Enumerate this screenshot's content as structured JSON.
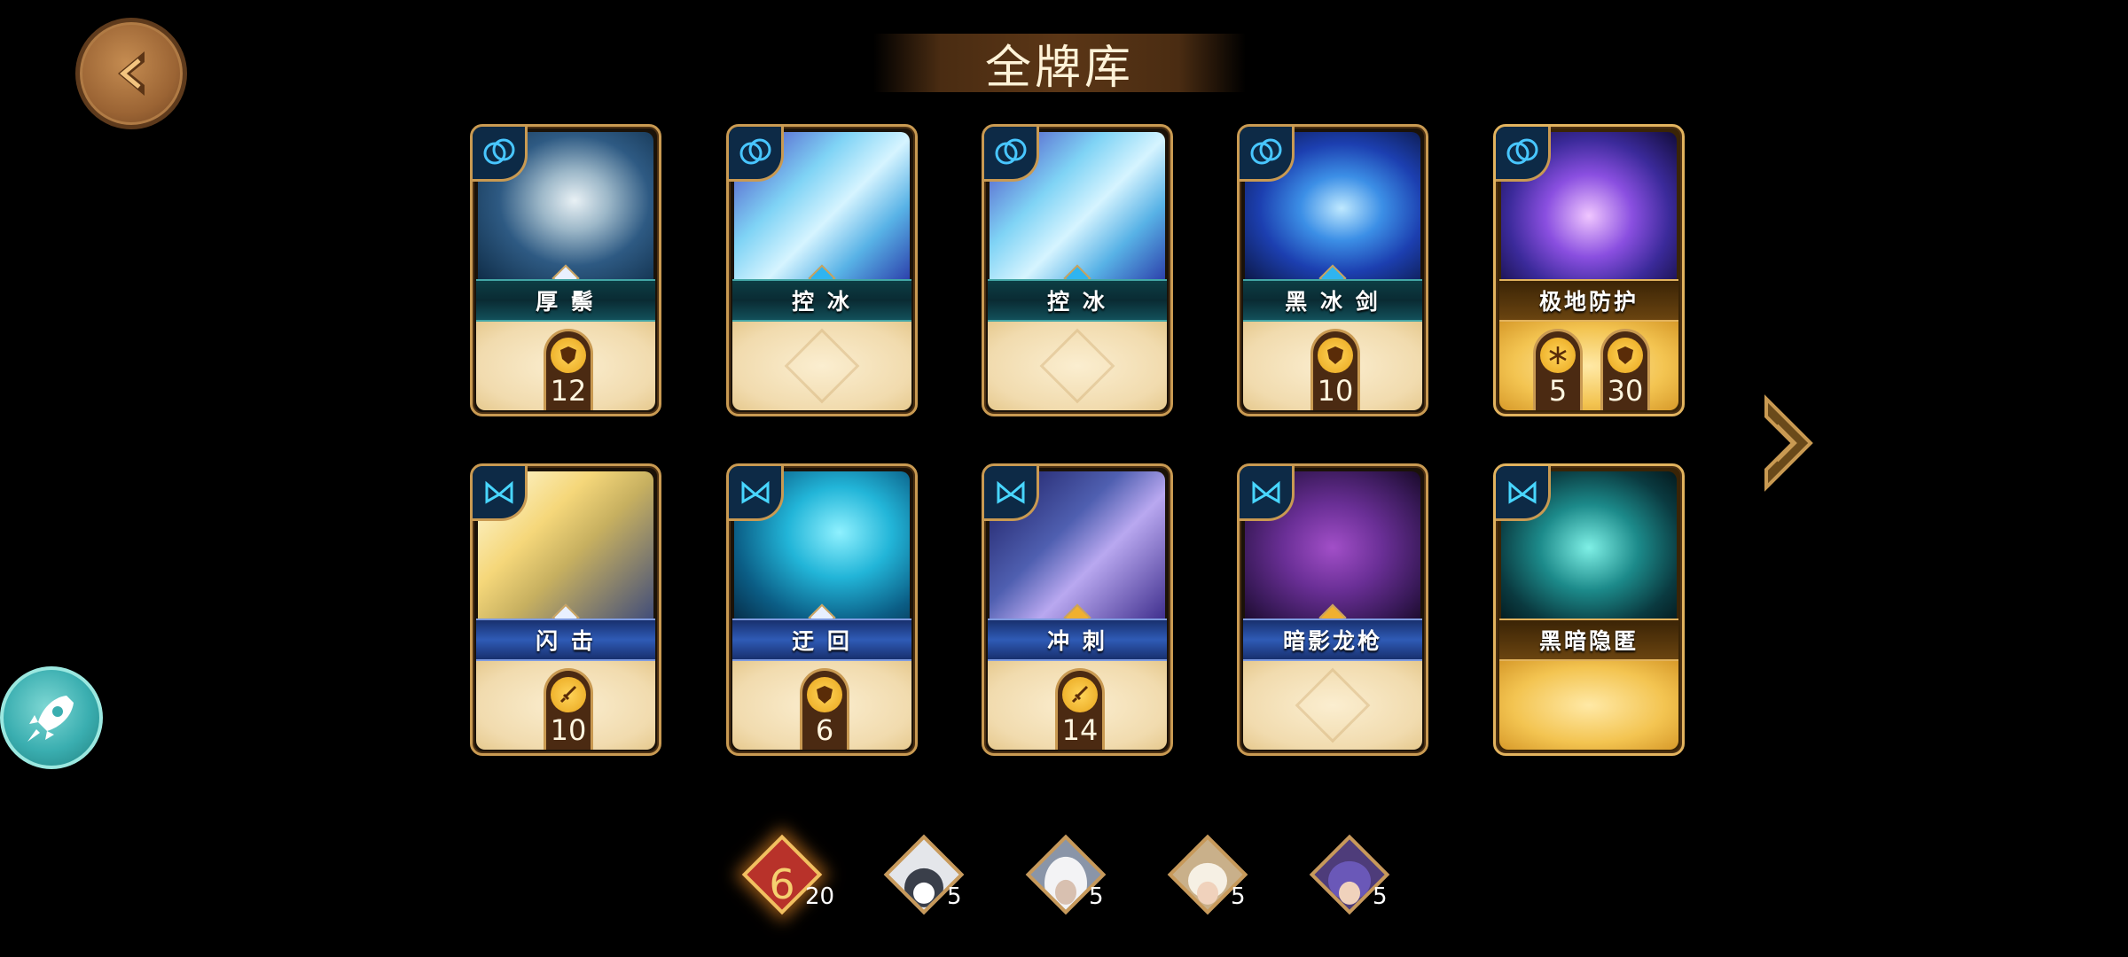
{
  "header": {
    "title": "全牌库"
  },
  "cards_row1": [
    {
      "name": "厚 鬃",
      "stats": [
        {
          "icon": "shield-icon",
          "value": "12"
        }
      ]
    },
    {
      "name": "控 冰",
      "stats": []
    },
    {
      "name": "控 冰",
      "stats": []
    },
    {
      "name": "黑 冰 剑",
      "stats": [
        {
          "icon": "shield-icon",
          "value": "10"
        }
      ]
    },
    {
      "name": "极地防护",
      "stats": [
        {
          "icon": "snowflake-icon",
          "value": "5"
        },
        {
          "icon": "shield-icon",
          "value": "30"
        }
      ]
    }
  ],
  "cards_row2": [
    {
      "name": "闪 击",
      "stats": [
        {
          "icon": "sword-icon",
          "value": "10"
        }
      ]
    },
    {
      "name": "迂 回",
      "stats": [
        {
          "icon": "shield-icon",
          "value": "6"
        }
      ]
    },
    {
      "name": "冲 刺",
      "stats": [
        {
          "icon": "sword-icon",
          "value": "14"
        }
      ]
    },
    {
      "name": "暗影龙枪",
      "stats": []
    },
    {
      "name": "黑暗隐匿",
      "stats": []
    }
  ],
  "heroes": [
    {
      "icon": "fire-emblem-icon",
      "count": "20",
      "selected": true
    },
    {
      "icon": "wolf-portrait-icon",
      "count": "5"
    },
    {
      "icon": "white-hair-portrait-icon",
      "count": "5"
    },
    {
      "icon": "elf-portrait-icon",
      "count": "5"
    },
    {
      "icon": "purple-hair-portrait-icon",
      "count": "5"
    }
  ],
  "colors": {
    "gold_frame": "#c99a52",
    "banner": "#5b3616",
    "teal_button": "#3aaeb0"
  }
}
